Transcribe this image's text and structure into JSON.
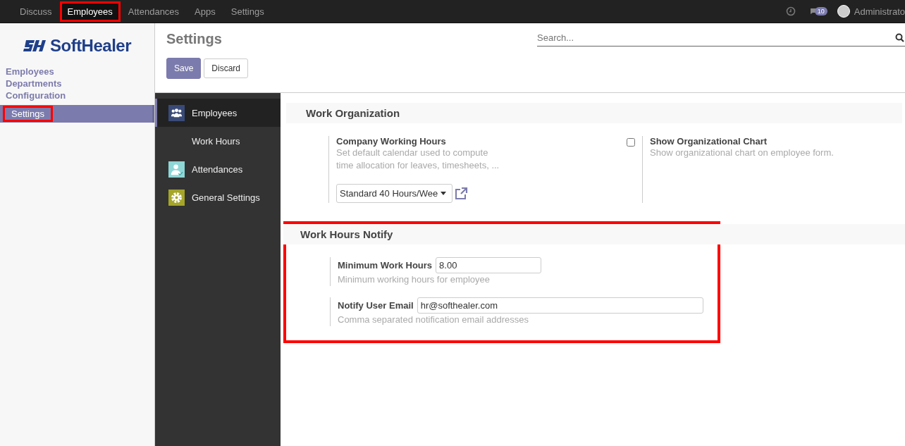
{
  "top_nav": {
    "items": [
      {
        "label": "Discuss",
        "selected": false,
        "highlighted": false
      },
      {
        "label": "Employees",
        "selected": true,
        "highlighted": true
      },
      {
        "label": "Attendances",
        "selected": false,
        "highlighted": false
      },
      {
        "label": "Apps",
        "selected": false,
        "highlighted": false
      },
      {
        "label": "Settings",
        "selected": false,
        "highlighted": false
      }
    ],
    "message_count": "10",
    "user": "Administrato"
  },
  "logo": {
    "text": "SoftHealer"
  },
  "sidebar": {
    "items": [
      {
        "label": "Employees",
        "selected": false,
        "highlighted": false
      },
      {
        "label": "Departments",
        "selected": false,
        "highlighted": false
      },
      {
        "label": "Configuration",
        "selected": false,
        "highlighted": false
      },
      {
        "label": "Settings",
        "selected": true,
        "highlighted": true
      }
    ]
  },
  "header": {
    "title": "Settings",
    "search": {
      "placeholder": "Search..."
    },
    "buttons": [
      {
        "label": "Save",
        "kind": "primary"
      },
      {
        "label": "Discard",
        "kind": "secondary"
      }
    ]
  },
  "settings_nav": [
    {
      "label": "Employees",
      "kind": "app",
      "selected": true
    },
    {
      "label": "Work Hours",
      "kind": "sub",
      "selected": false
    },
    {
      "label": "Attendances",
      "kind": "app",
      "selected": false
    },
    {
      "label": "General Settings",
      "kind": "app",
      "selected": false
    }
  ],
  "sections": [
    {
      "title": "Work Organization",
      "highlighted": false,
      "kind": "grid",
      "settings": [
        {
          "kind": "select",
          "label": "Company Working Hours",
          "description": "Set default calendar used to compute time allocation for leaves, timesheets, ...",
          "value": "Standard 40 Hours/Wee"
        },
        {
          "kind": "checkbox",
          "label": "Show Organizational Chart",
          "description": "Show organizational chart on employee form.",
          "checked": false
        }
      ]
    },
    {
      "title": "Work Hours Notify",
      "highlighted": true,
      "kind": "list",
      "settings": [
        {
          "kind": "input",
          "label": "Minimum Work Hours",
          "value": "8.00",
          "description": "Minimum working hours for employee"
        },
        {
          "kind": "input",
          "label": "Notify User Email",
          "value": "hr@softhealer.com",
          "description": "Comma separated notification email addresses"
        }
      ]
    }
  ]
}
